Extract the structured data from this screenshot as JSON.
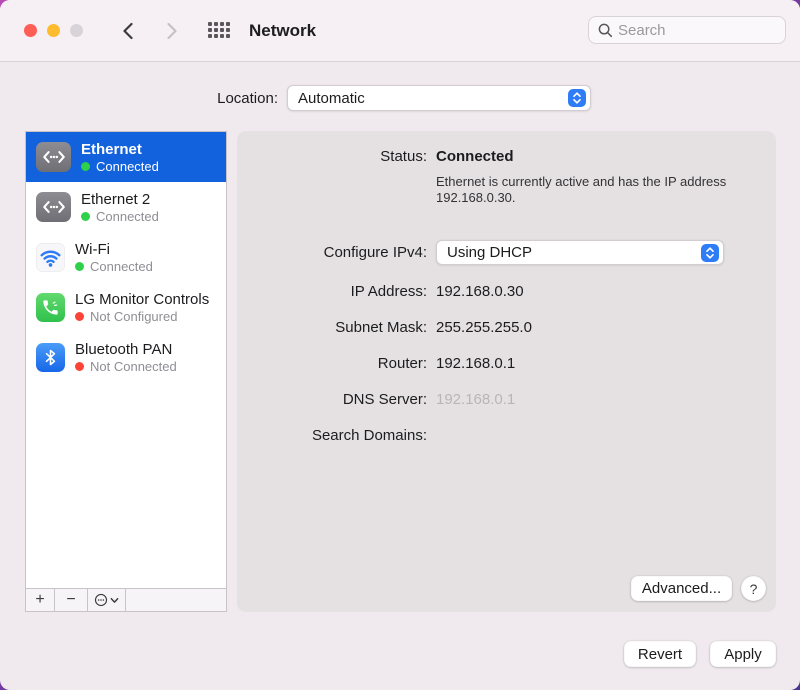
{
  "window": {
    "title": "Network"
  },
  "titlebar": {
    "search_placeholder": "Search"
  },
  "location": {
    "label": "Location:",
    "value": "Automatic"
  },
  "sidebar": {
    "items": [
      {
        "name": "Ethernet",
        "status": "Connected",
        "status_color": "green",
        "icon": "ethernet-icon",
        "selected": true
      },
      {
        "name": "Ethernet 2",
        "status": "Connected",
        "status_color": "green",
        "icon": "ethernet-icon",
        "selected": false
      },
      {
        "name": "Wi-Fi",
        "status": "Connected",
        "status_color": "green",
        "icon": "wifi-icon",
        "selected": false
      },
      {
        "name": "LG Monitor Controls",
        "status": "Not Configured",
        "status_color": "red",
        "icon": "phone-icon",
        "selected": false
      },
      {
        "name": "Bluetooth PAN",
        "status": "Not Connected",
        "status_color": "red",
        "icon": "bluetooth-icon",
        "selected": false
      }
    ],
    "toolbar": {
      "add_label": "+",
      "remove_label": "−"
    }
  },
  "panel": {
    "status_label": "Status:",
    "status_value": "Connected",
    "status_description": "Ethernet is currently active and has the IP address 192.168.0.30.",
    "configure_label": "Configure IPv4:",
    "configure_value": "Using DHCP",
    "fields": [
      {
        "label": "IP Address:",
        "value": "192.168.0.30",
        "dimmed": false
      },
      {
        "label": "Subnet Mask:",
        "value": "255.255.255.0",
        "dimmed": false
      },
      {
        "label": "Router:",
        "value": "192.168.0.1",
        "dimmed": false
      },
      {
        "label": "DNS Server:",
        "value": "192.168.0.1",
        "dimmed": true
      },
      {
        "label": "Search Domains:",
        "value": "",
        "dimmed": false
      }
    ],
    "advanced_label": "Advanced...",
    "help_label": "?"
  },
  "footer": {
    "revert_label": "Revert",
    "apply_label": "Apply"
  },
  "colors": {
    "selection_blue": "#1261dd",
    "status_green": "#2fd04a",
    "status_red": "#fb4338",
    "stepper_blue": "#2e7cf6",
    "panel_gray": "#e5e1e3",
    "window_bg": "#f0eaef"
  }
}
